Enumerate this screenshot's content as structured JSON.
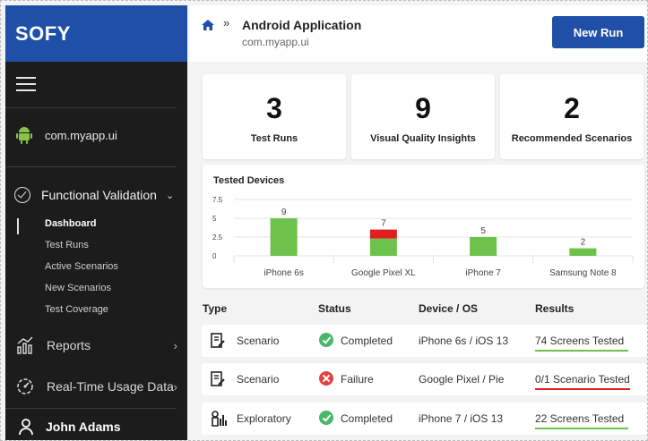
{
  "sidebar": {
    "brand": "SOFY",
    "app": "com.myapp.ui",
    "section": "Functional Validation",
    "sub_items": [
      "Dashboard",
      "Test Runs",
      "Active Scenarios",
      "New Scenarios",
      "Test Coverage"
    ],
    "reports": "Reports",
    "realtime": "Real-Time Usage Data",
    "user": "John Adams"
  },
  "header": {
    "title": "Android Application",
    "subtitle": "com.myapp.ui",
    "new_run": "New Run"
  },
  "stats": [
    {
      "value": "3",
      "label": "Test Runs"
    },
    {
      "value": "9",
      "label": "Visual Quality Insights"
    },
    {
      "value": "2",
      "label": "Recommended Scenarios"
    }
  ],
  "chart_data": {
    "type": "bar",
    "title": "Tested Devices",
    "categories": [
      "iPhone 6s",
      "Google Pixel XL",
      "iPhone 7",
      "Samsung Note 8"
    ],
    "totals": [
      9,
      7,
      5,
      2
    ],
    "series": [
      {
        "values": [
          5,
          2.3,
          2.5,
          1
        ],
        "color": "#6cc24a"
      },
      {
        "values": [
          0,
          1.2,
          0,
          0
        ],
        "color": "#e02020"
      }
    ],
    "yticks": [
      "7.5",
      "5",
      "2.5",
      "0"
    ],
    "ylim": [
      0,
      7.5
    ]
  },
  "table": {
    "headers": {
      "type": "Type",
      "status": "Status",
      "device": "Device / OS",
      "results": "Results"
    },
    "rows": [
      {
        "type": "Scenario",
        "status": "Completed",
        "device": "iPhone 6s  / iOS 13",
        "results": "74 Screens Tested",
        "ok": true
      },
      {
        "type": "Scenario",
        "status": "Failure",
        "device": "Google Pixel / Pie",
        "results": "0/1 Scenario Tested",
        "ok": false
      },
      {
        "type": "Exploratory",
        "status": "Completed",
        "device": "iPhone 7 / iOS 13",
        "results": "22 Screens Tested",
        "ok": true
      }
    ]
  },
  "colors": {
    "accent": "#1f4fa6",
    "success": "#47b86b",
    "failure": "#e04242"
  }
}
